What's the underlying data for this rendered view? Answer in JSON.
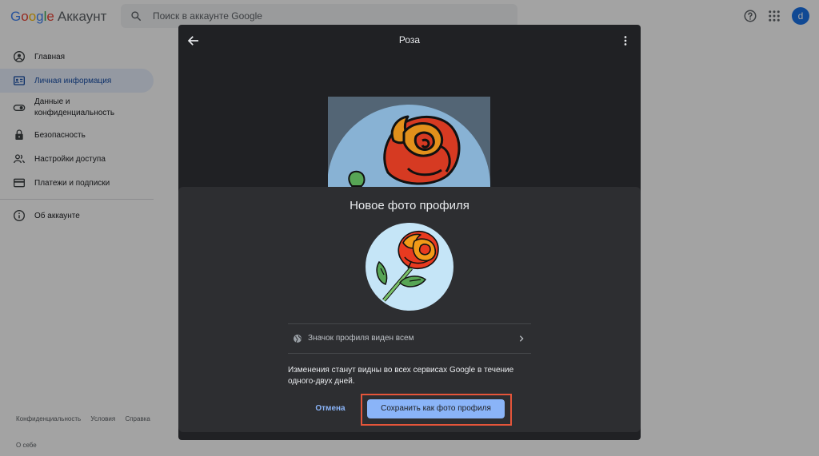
{
  "header": {
    "logo_letters": [
      "G",
      "o",
      "o",
      "g",
      "l",
      "e"
    ],
    "product": "Аккаунт",
    "search_placeholder": "Поиск в аккаунте Google",
    "avatar_letter": "d",
    "icons": [
      "search-icon",
      "help-icon",
      "apps-icon"
    ]
  },
  "sidebar": {
    "items": [
      {
        "label": "Главная",
        "icon": "home-icon"
      },
      {
        "label": "Личная информация",
        "icon": "id-card-icon",
        "active": true
      },
      {
        "label_lines": [
          "Данные и",
          "конфиденциальность"
        ],
        "icon": "toggle-icon"
      },
      {
        "label": "Безопасность",
        "icon": "lock-icon"
      },
      {
        "label": "Настройки доступа",
        "icon": "people-icon"
      },
      {
        "label": "Платежи и подписки",
        "icon": "card-icon"
      }
    ],
    "about": {
      "label": "Об аккаунте",
      "icon": "info-icon"
    }
  },
  "footer": {
    "links": [
      "Конфиденциальность",
      "Условия",
      "Справка"
    ],
    "about_me": "О себе"
  },
  "viewer": {
    "title": "Роза",
    "icons": [
      "back-arrow-icon",
      "more-vert-icon"
    ]
  },
  "dialog": {
    "title": "Новое фото профиля",
    "visibility_label": "Значок профиля виден всем",
    "info_text": "Изменения станут видны во всех сервисах Google в течение одного-двух дней.",
    "cancel_label": "Отмена",
    "save_label": "Сохранить как фото профиля",
    "highlight_color": "#e5553a",
    "accent_color": "#8ab4f8"
  }
}
